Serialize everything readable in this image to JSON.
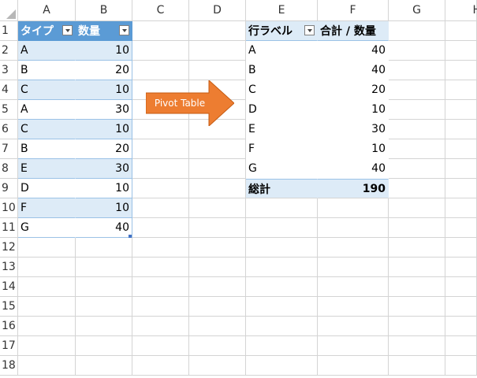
{
  "columns": [
    "A",
    "B",
    "C",
    "D",
    "E",
    "F",
    "G",
    "H"
  ],
  "rows": [
    "1",
    "2",
    "3",
    "4",
    "5",
    "6",
    "7",
    "8",
    "9",
    "10",
    "11",
    "12",
    "13",
    "14",
    "15",
    "16",
    "17",
    "18"
  ],
  "source_table": {
    "headers": [
      "タイプ",
      "数量"
    ],
    "rows": [
      [
        "A",
        "10"
      ],
      [
        "B",
        "20"
      ],
      [
        "C",
        "10"
      ],
      [
        "A",
        "30"
      ],
      [
        "C",
        "10"
      ],
      [
        "B",
        "20"
      ],
      [
        "E",
        "30"
      ],
      [
        "D",
        "10"
      ],
      [
        "F",
        "10"
      ],
      [
        "G",
        "40"
      ]
    ]
  },
  "arrow": {
    "label": "Pivot Table",
    "color": "#ed7d31"
  },
  "pivot_table": {
    "row_label_header": "行ラベル",
    "value_header": "合計 / 数量",
    "rows": [
      [
        "A",
        "40"
      ],
      [
        "B",
        "40"
      ],
      [
        "C",
        "20"
      ],
      [
        "D",
        "10"
      ],
      [
        "E",
        "30"
      ],
      [
        "F",
        "10"
      ],
      [
        "G",
        "40"
      ]
    ],
    "total_label": "総計",
    "total_value": "190"
  },
  "colors": {
    "table_header": "#5b9bd5",
    "table_band": "#ddebf7",
    "gridline": "#d4d4d4"
  }
}
